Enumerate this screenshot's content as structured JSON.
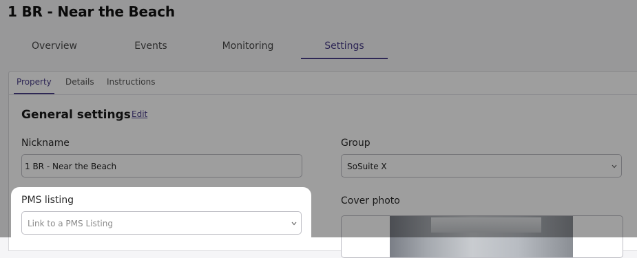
{
  "page": {
    "title": "1 BR - Near the Beach"
  },
  "main_tabs": [
    {
      "label": "Overview",
      "active": false
    },
    {
      "label": "Events",
      "active": false
    },
    {
      "label": "Monitoring",
      "active": false
    },
    {
      "label": "Settings",
      "active": true
    }
  ],
  "sub_tabs": [
    {
      "label": "Property",
      "active": true
    },
    {
      "label": "Details",
      "active": false
    },
    {
      "label": "Instructions",
      "active": false
    }
  ],
  "general_settings": {
    "title": "General settings",
    "edit_label": "Edit",
    "nickname": {
      "label": "Nickname",
      "value": "1 BR - Near the Beach"
    },
    "group": {
      "label": "Group",
      "value": "SoSuite X"
    },
    "pms_listing": {
      "label": "PMS listing",
      "placeholder": "Link to a PMS Listing"
    },
    "cover_photo": {
      "label": "Cover photo"
    }
  },
  "colors": {
    "accent": "#4b3f8a",
    "overlay": "rgba(0,0,0,0.38)"
  },
  "icons": {
    "dropdown": "chevron-down-icon"
  }
}
